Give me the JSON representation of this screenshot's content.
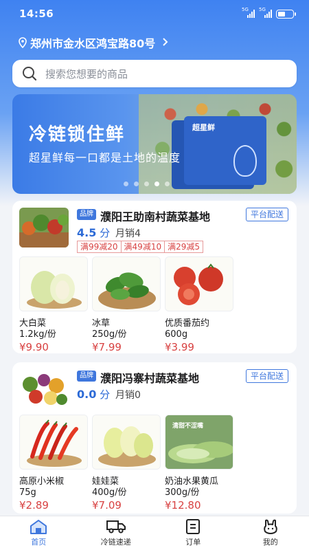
{
  "status_bar": {
    "time": "14:56",
    "signal1": "5G",
    "signal2": "5G"
  },
  "location": {
    "address": "郑州市金水区鸿宝路80号",
    "pin_icon": "location-pin-icon",
    "chevron_icon": "chevron-right-icon"
  },
  "search": {
    "placeholder": "搜索您想要的商品",
    "icon": "search-icon"
  },
  "banner": {
    "title": "冷链锁住鲜",
    "subtitle": "超星鲜每一口都是土地的温度",
    "box_brand": "超星鲜",
    "dot_count": 5,
    "active_dot": 3
  },
  "stores": [
    {
      "badge": "品牌",
      "name": "濮阳王助南村蔬菜基地",
      "delivery": "平台配送",
      "rating": "4.5",
      "rating_unit": "分",
      "sales_label": "月销",
      "sales": "4",
      "promos": [
        "满99减20",
        "满49减10",
        "满29减5"
      ],
      "products": [
        {
          "name": "大白菜",
          "spec": "1.2kg/份",
          "price": "¥9.90"
        },
        {
          "name": "冰草",
          "spec": "250g/份",
          "price": "¥7.99"
        },
        {
          "name": "优质番茄约",
          "spec": "600g",
          "price": "¥3.99"
        }
      ]
    },
    {
      "badge": "品牌",
      "name": "濮阳冯寨村蔬菜基地",
      "delivery": "平台配送",
      "rating": "0.0",
      "rating_unit": "分",
      "sales_label": "月销",
      "sales": "0",
      "promos": [],
      "products": [
        {
          "name": "高原小米椒",
          "spec": "75g",
          "price": "¥2.89"
        },
        {
          "name": "娃娃菜",
          "spec": "400g/份",
          "price": "¥7.09"
        },
        {
          "name": "奶油水果黄瓜",
          "spec": "300g/份",
          "price": "¥12.80",
          "overlay": "清甜不涩嘴"
        }
      ]
    }
  ],
  "tabbar": {
    "active": 0,
    "items": [
      {
        "label": "首页",
        "icon": "home-icon"
      },
      {
        "label": "冷链速递",
        "icon": "truck-icon"
      },
      {
        "label": "订单",
        "icon": "order-list-icon"
      },
      {
        "label": "我的",
        "icon": "profile-icon"
      }
    ]
  },
  "colors": {
    "primary": "#3f77dd",
    "price": "#d84242",
    "header_start": "#3f82f1"
  }
}
